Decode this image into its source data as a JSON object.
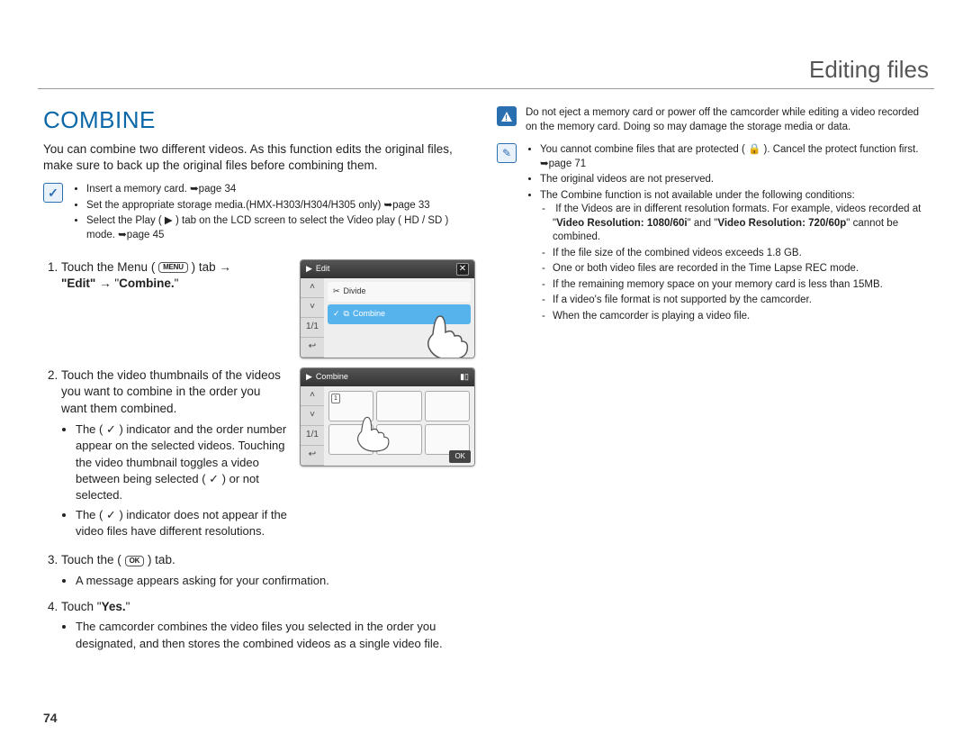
{
  "header": {
    "title": "Editing files"
  },
  "page_number": "74",
  "section": {
    "title": "COMBINE"
  },
  "intro": "You can combine two different videos. As this function edits the original files, make sure to back up the original files before combining them.",
  "prereq": {
    "items": [
      "Insert a memory card. ➥page 34",
      "Set the appropriate storage media.(HMX-H303/H304/H305 only) ➥page 33",
      "Select the Play ( ▶ ) tab on the LCD screen to select the Video play ( HD / SD ) mode. ➥page 45"
    ]
  },
  "screens": {
    "edit": {
      "title": "Edit",
      "row_divide": "Divide",
      "row_combine": "Combine",
      "page": "1/1"
    },
    "combine": {
      "title": "Combine",
      "page": "1/1",
      "thumb_1": "1",
      "ok": "OK"
    }
  },
  "steps": {
    "s1_a": "Touch the Menu (",
    "s1_menu_key": "MENU",
    "s1_b": ") tab →",
    "s1_c": "\"Edit\"",
    "s1_d": " → \"",
    "s1_e": "Combine.",
    "s1_f": "\"",
    "s2": "Touch the video thumbnails of the videos you want to combine in the order you want them combined.",
    "s2_b1": "The ( ✓ ) indicator and the order number appear on the selected videos. Touching the video thumbnail toggles a video  between being selected ( ✓ ) or not selected.",
    "s2_b2": "The ( ✓ ) indicator does not appear if the video files have different resolutions.",
    "s3_a": "Touch the (",
    "s3_ok_key": "OK",
    "s3_b": ") tab.",
    "s3_bullet": "A message appears asking for your confirmation.",
    "s4_a": "Touch \"",
    "s4_yes": "Yes.",
    "s4_b": "\"",
    "s4_bullet": "The camcorder combines the video files you selected in the order you designated, and then stores the combined videos as a single video file."
  },
  "warn": "Do not eject a memory card or power off the camcorder while editing a video recorded on the memory card. Doing so may damage the storage media or data.",
  "notes": {
    "n1": "You cannot combine files that are protected ( 🔒 ). Cancel the protect function first. ➥page 71",
    "n2": "The original videos are not preserved.",
    "n3": "The Combine function is not available under the following conditions:",
    "n3a_a": "If the Videos are in different resolution formats. For example, videos recorded at \"",
    "n3a_b": "Video Resolution: 1080/60i",
    "n3a_c": "\" and \"",
    "n3a_d": "Video Resolution: 720/60p",
    "n3a_e": "\" cannot be combined.",
    "n3b": "If the file size of the combined videos exceeds 1.8 GB.",
    "n3c": "One or both video files are recorded in the Time Lapse REC mode.",
    "n3d": "If the remaining memory space on your memory card is less than 15MB.",
    "n3e": "If a video's file format is not supported by the camcorder.",
    "n3f": "When the camcorder is playing a video file."
  }
}
